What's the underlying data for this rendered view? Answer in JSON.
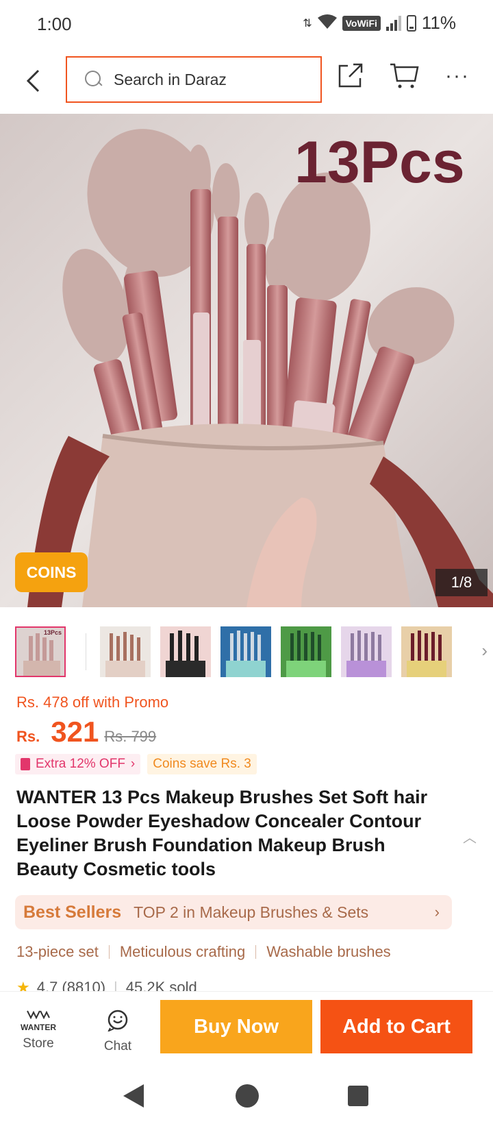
{
  "status_bar": {
    "time": "1:00",
    "network": "VoWiFi",
    "battery": "11%"
  },
  "header": {
    "search_placeholder": "Search in Daraz"
  },
  "gallery": {
    "overlay_text": "13Pcs",
    "coins_badge": "COINS",
    "page_indicator": "1/8",
    "thumbnails": [
      "thumb-1",
      "thumb-2",
      "thumb-3",
      "thumb-4",
      "thumb-5",
      "thumb-6",
      "thumb-7"
    ],
    "thumb_overlay": "13Pcs"
  },
  "price": {
    "promo": "Rs. 478 off with Promo",
    "currency": "Rs.",
    "current": "321",
    "original": "Rs. 799",
    "extra_off": "Extra 12% OFF",
    "coins_save": "Coins save Rs. 3"
  },
  "product": {
    "title": "WANTER 13 Pcs Makeup Brushes Set Soft hair Loose Powder Eyeshadow Concealer Contour Eyeliner Brush Foundation Makeup Brush Beauty Cosmetic tools",
    "best_seller_label": "Best Sellers",
    "best_seller_text": "TOP 2 in Makeup Brushes & Sets",
    "features": [
      "13-piece set",
      "Meticulous crafting",
      "Washable brushes"
    ],
    "rating": "4.7 (8810)",
    "sold": "45.2K sold"
  },
  "action_bar": {
    "store_logo": "WANTER",
    "store_label": "Store",
    "chat_label": "Chat",
    "buy_now": "Buy Now",
    "add_to_cart": "Add to Cart"
  },
  "colors": {
    "accent": "#f0541f",
    "buy_now": "#f9a51c",
    "add_to_cart": "#f55214",
    "coins": "#f5a20f"
  }
}
